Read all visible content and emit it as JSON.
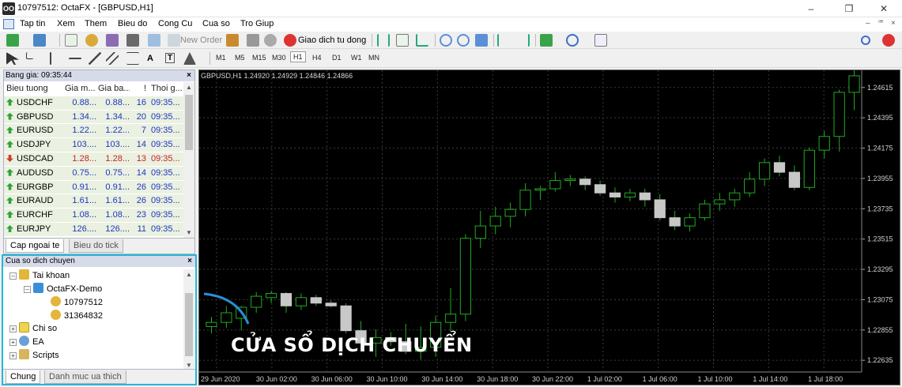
{
  "window": {
    "app_icon": "OO",
    "title": "10797512: OctaFX - [GBPUSD,H1]",
    "minimize": "–",
    "maximize": "❐",
    "close": "✕"
  },
  "menu": {
    "items": [
      "Tap tin",
      "Xem",
      "Them",
      "Bieu do",
      "Cong Cu",
      "Cua so",
      "Tro Giup"
    ],
    "mdi": [
      "–",
      "ꟹ",
      "×"
    ]
  },
  "toolbar1": {
    "new_order": "New Order",
    "auto_trading": "Giao dich tu dong"
  },
  "toolbar2": {
    "text_tool": "A",
    "label_tool": "T",
    "timeframes": [
      "M1",
      "M5",
      "M15",
      "M30",
      "H1",
      "H4",
      "D1",
      "W1",
      "MN"
    ],
    "active_timeframe": "H1"
  },
  "market_watch": {
    "title": "Bang gia: 09:35:44",
    "close": "×",
    "headers": [
      "Bieu tuong",
      "Gia m...",
      "Gia ba...",
      "!",
      "Thoi g..."
    ],
    "rows": [
      {
        "symbol": "USDCHF",
        "bid": "0.88...",
        "ask": "0.88...",
        "spread": "16",
        "time": "09:35...",
        "dir": "up"
      },
      {
        "symbol": "GBPUSD",
        "bid": "1.34...",
        "ask": "1.34...",
        "spread": "20",
        "time": "09:35...",
        "dir": "up"
      },
      {
        "symbol": "EURUSD",
        "bid": "1.22...",
        "ask": "1.22...",
        "spread": "7",
        "time": "09:35...",
        "dir": "up"
      },
      {
        "symbol": "USDJPY",
        "bid": "103....",
        "ask": "103....",
        "spread": "14",
        "time": "09:35...",
        "dir": "up"
      },
      {
        "symbol": "USDCAD",
        "bid": "1.28...",
        "ask": "1.28...",
        "spread": "13",
        "time": "09:35...",
        "dir": "down"
      },
      {
        "symbol": "AUDUSD",
        "bid": "0.75...",
        "ask": "0.75...",
        "spread": "14",
        "time": "09:35...",
        "dir": "up"
      },
      {
        "symbol": "EURGBP",
        "bid": "0.91...",
        "ask": "0.91...",
        "spread": "26",
        "time": "09:35...",
        "dir": "up"
      },
      {
        "symbol": "EURAUD",
        "bid": "1.61...",
        "ask": "1.61...",
        "spread": "26",
        "time": "09:35...",
        "dir": "up"
      },
      {
        "symbol": "EURCHF",
        "bid": "1.08...",
        "ask": "1.08...",
        "spread": "23",
        "time": "09:35...",
        "dir": "up"
      },
      {
        "symbol": "EURJPY",
        "bid": "126....",
        "ask": "126....",
        "spread": "11",
        "time": "09:35...",
        "dir": "up"
      }
    ],
    "tabs": [
      "Cap ngoai te",
      "Bieu do tick"
    ],
    "active_tab": 0
  },
  "navigator": {
    "title": "Cua so dich chuyen",
    "close": "×",
    "accounts_label": "Tai khoan",
    "server": "OctaFX-Demo",
    "accounts": [
      "10797512",
      "31364832"
    ],
    "indicators": "Chi so",
    "experts": "EA",
    "scripts": "Scripts",
    "tabs": [
      "Chung",
      "Danh muc ua thich"
    ],
    "active_tab": 0
  },
  "overlay": {
    "caption": "CỬA SỔ DỊCH CHUYỂN"
  },
  "colors": {
    "chart_bg": "#000000",
    "candle_up": "#ffffff",
    "candle_down": "#c8c8c8",
    "wick": "#22aa22",
    "grid": "#3a3a3a",
    "highlight": "#25b6d6"
  },
  "chart_data": {
    "type": "candlestick",
    "header": "GBPUSD,H1  1.24920 1.24929 1.24846 1.24866",
    "y_ticks": [
      "1.24615",
      "1.24395",
      "1.24175",
      "1.23955",
      "1.23735",
      "1.23515",
      "1.23295",
      "1.23075",
      "1.22855",
      "1.22635"
    ],
    "ylim": [
      1.2255,
      1.2474
    ],
    "x_ticks": [
      "29 Jun 2020",
      "30 Jun 02:00",
      "30 Jun 06:00",
      "30 Jun 10:00",
      "30 Jun 14:00",
      "30 Jun 18:00",
      "30 Jun 22:00",
      "1 Jul 02:00",
      "1 Jul 06:00",
      "1 Jul 10:00",
      "1 Jul 14:00",
      "1 Jul 18:00"
    ],
    "grid": true,
    "ohlc": [
      [
        1.2288,
        1.2295,
        1.2283,
        1.2291
      ],
      [
        1.2291,
        1.2303,
        1.2287,
        1.2298
      ],
      [
        1.2294,
        1.2303,
        1.2285,
        1.2302
      ],
      [
        1.2302,
        1.2313,
        1.2298,
        1.231
      ],
      [
        1.2309,
        1.2314,
        1.2305,
        1.2312
      ],
      [
        1.2312,
        1.2313,
        1.2298,
        1.2303
      ],
      [
        1.2303,
        1.2312,
        1.23,
        1.2309
      ],
      [
        1.2309,
        1.2311,
        1.2303,
        1.2305
      ],
      [
        1.2305,
        1.2307,
        1.2302,
        1.2303
      ],
      [
        1.2303,
        1.2305,
        1.2283,
        1.2285
      ],
      [
        1.2285,
        1.2292,
        1.227,
        1.2276
      ],
      [
        1.2276,
        1.2286,
        1.2266,
        1.228
      ],
      [
        1.228,
        1.2284,
        1.2274,
        1.2277
      ],
      [
        1.2277,
        1.229,
        1.2268,
        1.227
      ],
      [
        1.227,
        1.2288,
        1.2264,
        1.2273
      ],
      [
        1.2273,
        1.2296,
        1.2266,
        1.2291
      ],
      [
        1.2291,
        1.2316,
        1.2284,
        1.2297
      ],
      [
        1.2297,
        1.2355,
        1.2292,
        1.2352
      ],
      [
        1.2352,
        1.2372,
        1.2345,
        1.2361
      ],
      [
        1.2361,
        1.2375,
        1.2355,
        1.2368
      ],
      [
        1.2368,
        1.2378,
        1.236,
        1.2373
      ],
      [
        1.2373,
        1.2392,
        1.2368,
        1.2387
      ],
      [
        1.2387,
        1.239,
        1.238,
        1.2388
      ],
      [
        1.2388,
        1.24,
        1.2386,
        1.2394
      ],
      [
        1.2394,
        1.2398,
        1.239,
        1.2395
      ],
      [
        1.2395,
        1.2397,
        1.2387,
        1.2391
      ],
      [
        1.2391,
        1.2394,
        1.2383,
        1.2385
      ],
      [
        1.2385,
        1.2389,
        1.2378,
        1.2382
      ],
      [
        1.2382,
        1.2388,
        1.2379,
        1.2385
      ],
      [
        1.2385,
        1.2388,
        1.2375,
        1.238
      ],
      [
        1.238,
        1.2384,
        1.2365,
        1.2367
      ],
      [
        1.2367,
        1.2372,
        1.2358,
        1.2361
      ],
      [
        1.2361,
        1.237,
        1.2357,
        1.2367
      ],
      [
        1.2367,
        1.238,
        1.2365,
        1.2377
      ],
      [
        1.2377,
        1.2385,
        1.2372,
        1.238
      ],
      [
        1.238,
        1.2388,
        1.2375,
        1.2385
      ],
      [
        1.2385,
        1.24,
        1.2382,
        1.2395
      ],
      [
        1.2395,
        1.241,
        1.239,
        1.2407
      ],
      [
        1.2407,
        1.2412,
        1.2397,
        1.24
      ],
      [
        1.24,
        1.2405,
        1.2387,
        1.2389
      ],
      [
        1.2389,
        1.2418,
        1.2387,
        1.2416
      ],
      [
        1.2416,
        1.243,
        1.241,
        1.2426
      ],
      [
        1.2426,
        1.246,
        1.2415,
        1.2458
      ],
      [
        1.2458,
        1.2477,
        1.2445,
        1.247
      ]
    ]
  }
}
